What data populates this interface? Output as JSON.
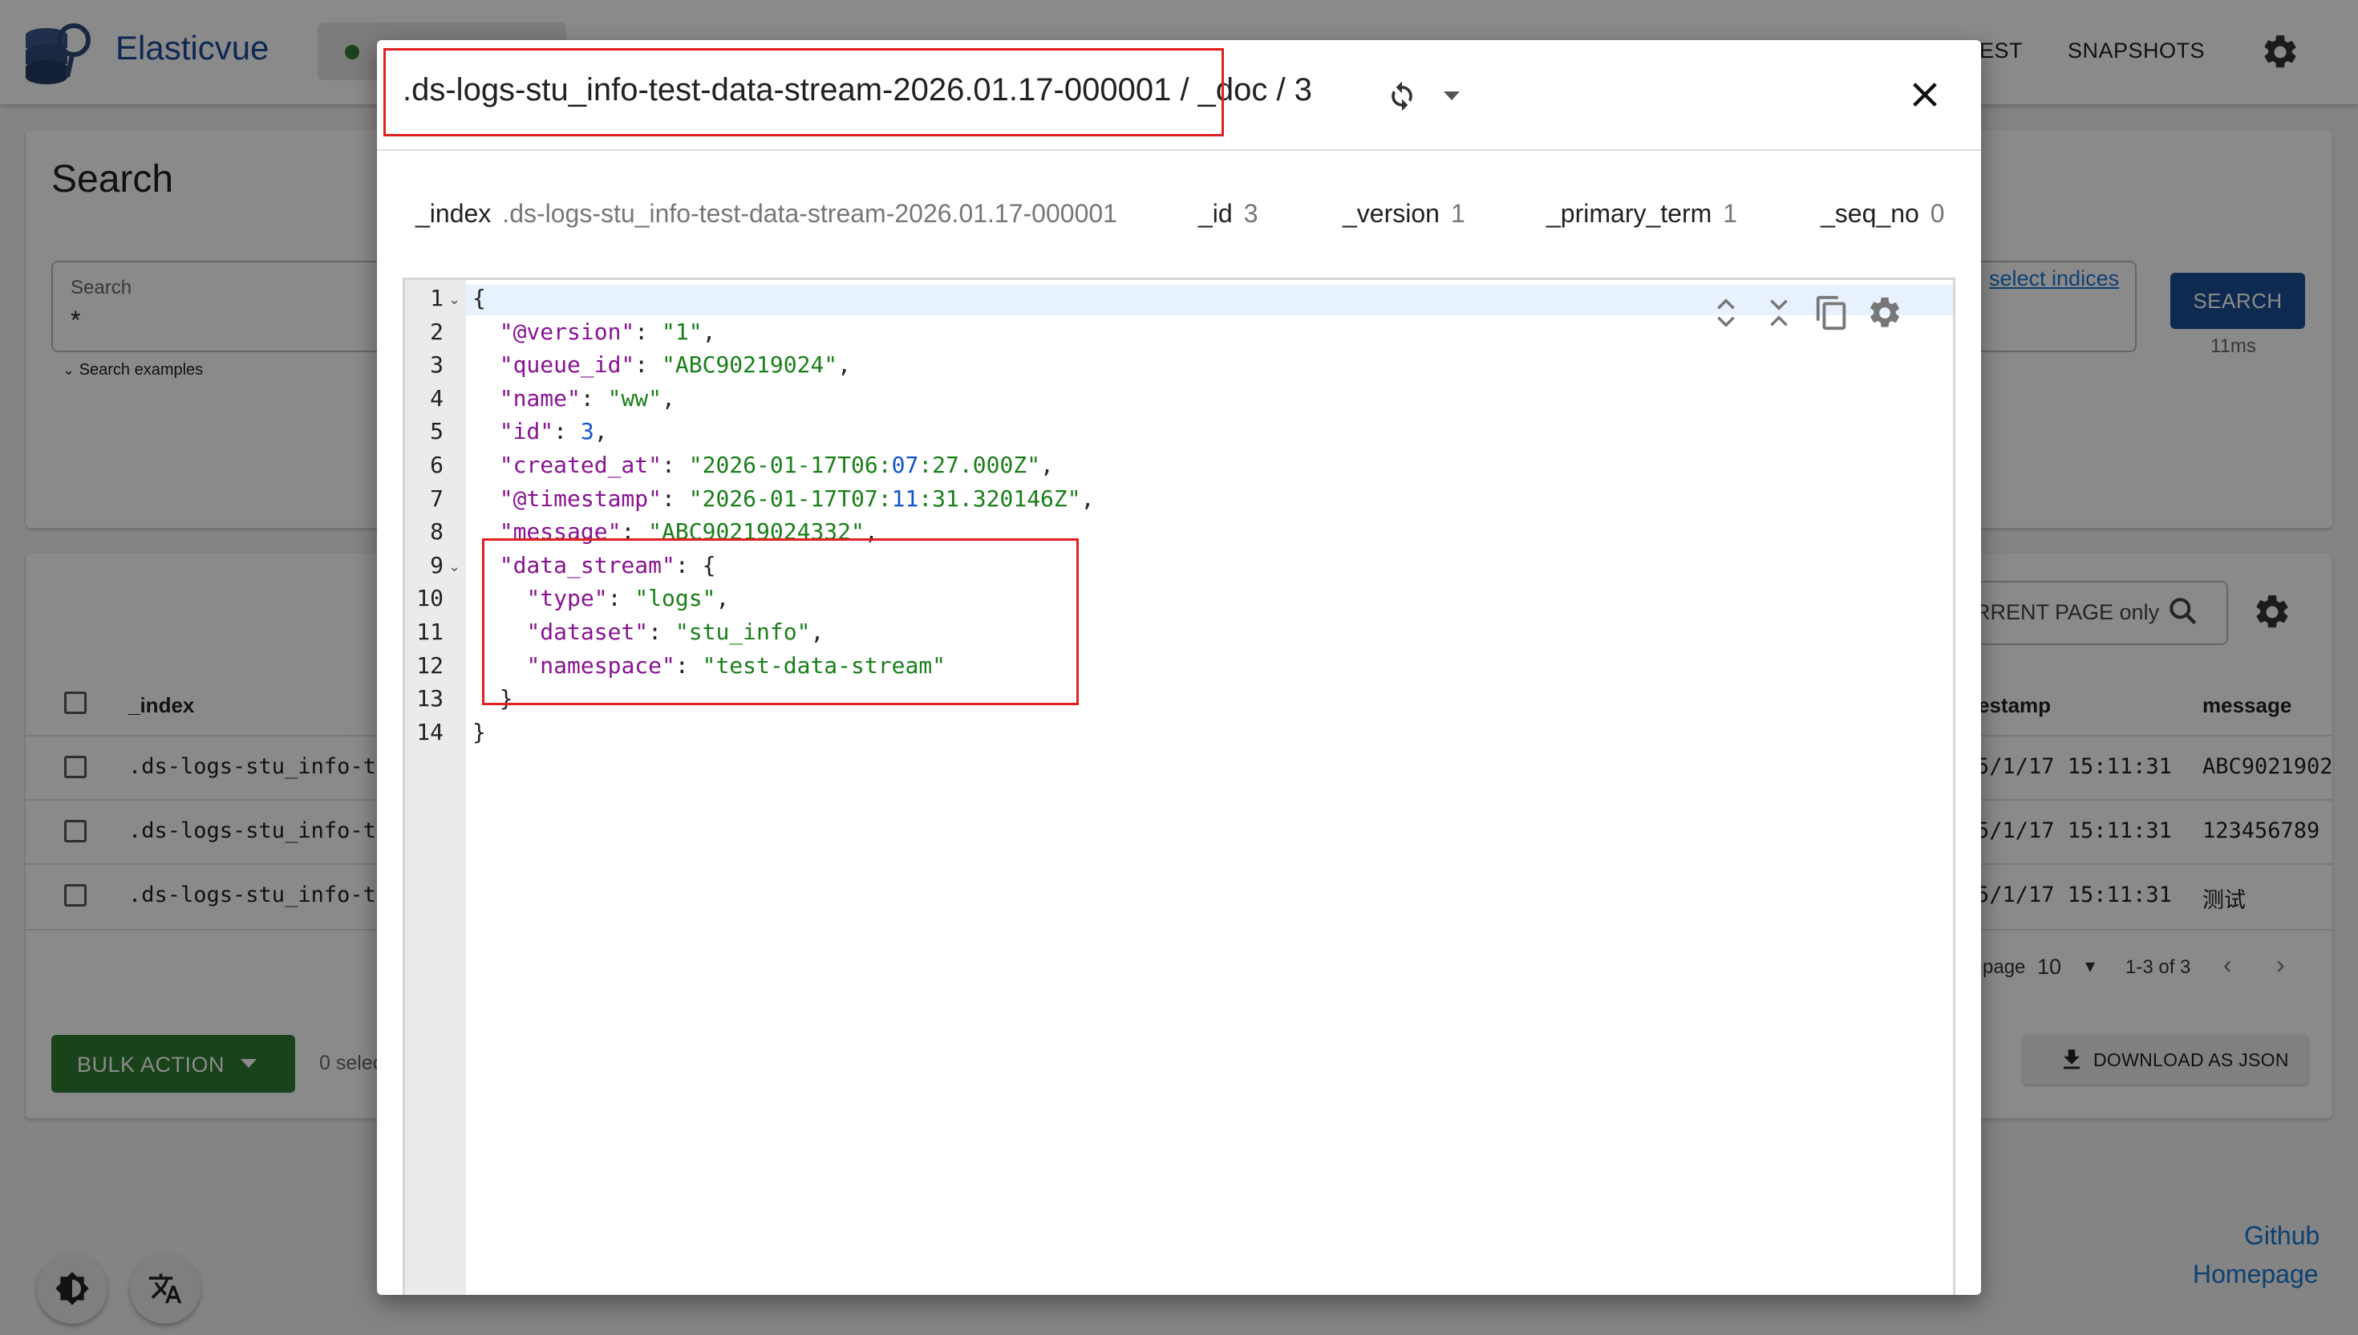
{
  "app": {
    "brand": "Elasticvue",
    "nav": [
      "EST",
      "SNAPSHOTS"
    ]
  },
  "search_panel": {
    "title": "Search",
    "field_label": "Search",
    "field_value": "*",
    "examples_label": "Search examples",
    "select_indices": "select indices",
    "search_button": "SEARCH",
    "took": "11ms"
  },
  "results": {
    "filter_placeholder": "RRENT PAGE only",
    "columns": {
      "index": "_index",
      "timestamp": "estamp",
      "message": "message"
    },
    "rows": [
      {
        "index": ".ds-logs-stu_info-t",
        "timestamp": "5/1/17 15:11:31",
        "message": "ABC9021902"
      },
      {
        "index": ".ds-logs-stu_info-t",
        "timestamp": "5/1/17 15:11:31",
        "message": "123456789"
      },
      {
        "index": ".ds-logs-stu_info-t",
        "timestamp": "5/1/17 15:11:31",
        "message": "测试"
      }
    ],
    "pager": {
      "per_page_label": "page",
      "per_page": "10",
      "range": "1-3 of 3"
    },
    "bulk_action": "BULK ACTION",
    "selected": "0 selec",
    "download": "DOWNLOAD AS JSON"
  },
  "footer": {
    "github": "Github",
    "homepage": "Homepage"
  },
  "dialog": {
    "title_index": ".ds-logs-stu_info-test-data-stream-2026.01.17-000001",
    "title_rest": " / _doc / 3",
    "meta": {
      "index_key": "_index",
      "index_val": ".ds-logs-stu_info-test-data-stream-2026.01.17-000001",
      "id_key": "_id",
      "id_val": "3",
      "version_key": "_version",
      "version_val": "1",
      "primary_term_key": "_primary_term",
      "primary_term_val": "1",
      "seq_no_key": "_seq_no",
      "seq_no_val": "0"
    },
    "json_lines": [
      "{",
      "  \"@version\": \"1\",",
      "  \"queue_id\": \"ABC90219024\",",
      "  \"name\": \"ww\",",
      "  \"id\": 3,",
      "  \"created_at\": \"2026-01-17T06:07:27.000Z\",",
      "  \"@timestamp\": \"2026-01-17T07:11:31.320146Z\",",
      "  \"message\": \"ABC90219024332\",",
      "  \"data_stream\": {",
      "    \"type\": \"logs\",",
      "    \"dataset\": \"stu_info\",",
      "    \"namespace\": \"test-data-stream\"",
      "  }",
      "}"
    ],
    "line_numbers": [
      "1",
      "2",
      "3",
      "4",
      "5",
      "6",
      "7",
      "8",
      "9",
      "10",
      "11",
      "12",
      "13",
      "14"
    ]
  },
  "colors": {
    "key": "#881391",
    "string": "#1a7f1a",
    "number": "#1155cc",
    "brand": "#1b4a9c",
    "highlight": "#e02020"
  }
}
